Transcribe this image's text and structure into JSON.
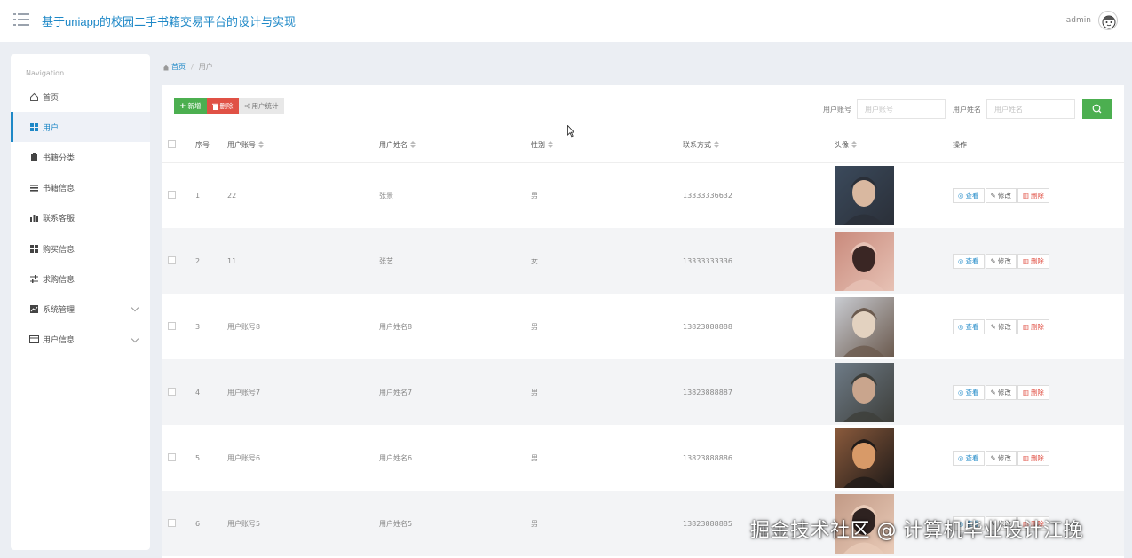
{
  "header": {
    "title": "基于uniapp的校园二手书籍交易平台的设计与实现",
    "user_name": "admin"
  },
  "sidebar": {
    "caption": "Navigation",
    "items": [
      {
        "label": "首页",
        "icon": "home-icon"
      },
      {
        "label": "用户",
        "icon": "grid-icon",
        "active": true
      },
      {
        "label": "书籍分类",
        "icon": "clipboard-icon"
      },
      {
        "label": "书籍信息",
        "icon": "list-icon"
      },
      {
        "label": "联系客服",
        "icon": "bar-chart-icon"
      },
      {
        "label": "购买信息",
        "icon": "grid-icon"
      },
      {
        "label": "求购信息",
        "icon": "sliders-icon"
      },
      {
        "label": "系统管理",
        "icon": "line-chart-icon",
        "expandable": true
      },
      {
        "label": "用户信息",
        "icon": "card-icon",
        "expandable": true
      }
    ]
  },
  "breadcrumb": {
    "home": "首页",
    "current": "用户"
  },
  "toolbar": {
    "add_label": "新增",
    "delete_label": "删除",
    "stats_label": "用户统计"
  },
  "search": {
    "account_label": "用户账号",
    "account_placeholder": "用户账号",
    "name_label": "用户姓名",
    "name_placeholder": "用户姓名"
  },
  "table": {
    "columns": [
      "序号",
      "用户账号",
      "用户姓名",
      "性别",
      "联系方式",
      "头像",
      "操作"
    ],
    "rows": [
      {
        "index": "1",
        "account": "22",
        "name": "张景",
        "gender": "男",
        "phone": "13333336632",
        "photo_colors": [
          "#3b4a5c",
          "#d9b8a0",
          "#2a2f38"
        ]
      },
      {
        "index": "2",
        "account": "11",
        "name": "张艺",
        "gender": "女",
        "phone": "13333333336",
        "photo_colors": [
          "#c98a7c",
          "#3a2624",
          "#e7c2b5"
        ]
      },
      {
        "index": "3",
        "account": "用户账号8",
        "name": "用户姓名8",
        "gender": "男",
        "phone": "13823888888",
        "photo_colors": [
          "#c9ccd2",
          "#e3d2c0",
          "#6b5a4e"
        ]
      },
      {
        "index": "4",
        "account": "用户账号7",
        "name": "用户姓名7",
        "gender": "男",
        "phone": "13823888887",
        "photo_colors": [
          "#6e7b87",
          "#c9a58d",
          "#3d3e3a"
        ]
      },
      {
        "index": "5",
        "account": "用户账号6",
        "name": "用户姓名6",
        "gender": "男",
        "phone": "13823888886",
        "photo_colors": [
          "#8a5a3c",
          "#d89a68",
          "#1f1a18"
        ]
      },
      {
        "index": "6",
        "account": "用户账号5",
        "name": "用户姓名5",
        "gender": "男",
        "phone": "13823888885",
        "photo_colors": [
          "#c29a86",
          "#2e2220",
          "#e9cbb8"
        ]
      }
    ],
    "actions": {
      "view": "查看",
      "edit": "修改",
      "delete": "删除"
    }
  },
  "watermark": "掘金技术社区 @ 计算机毕业设计江挽",
  "colors": {
    "accent": "#1e88c7",
    "success": "#4caf50",
    "danger": "#e05145"
  }
}
